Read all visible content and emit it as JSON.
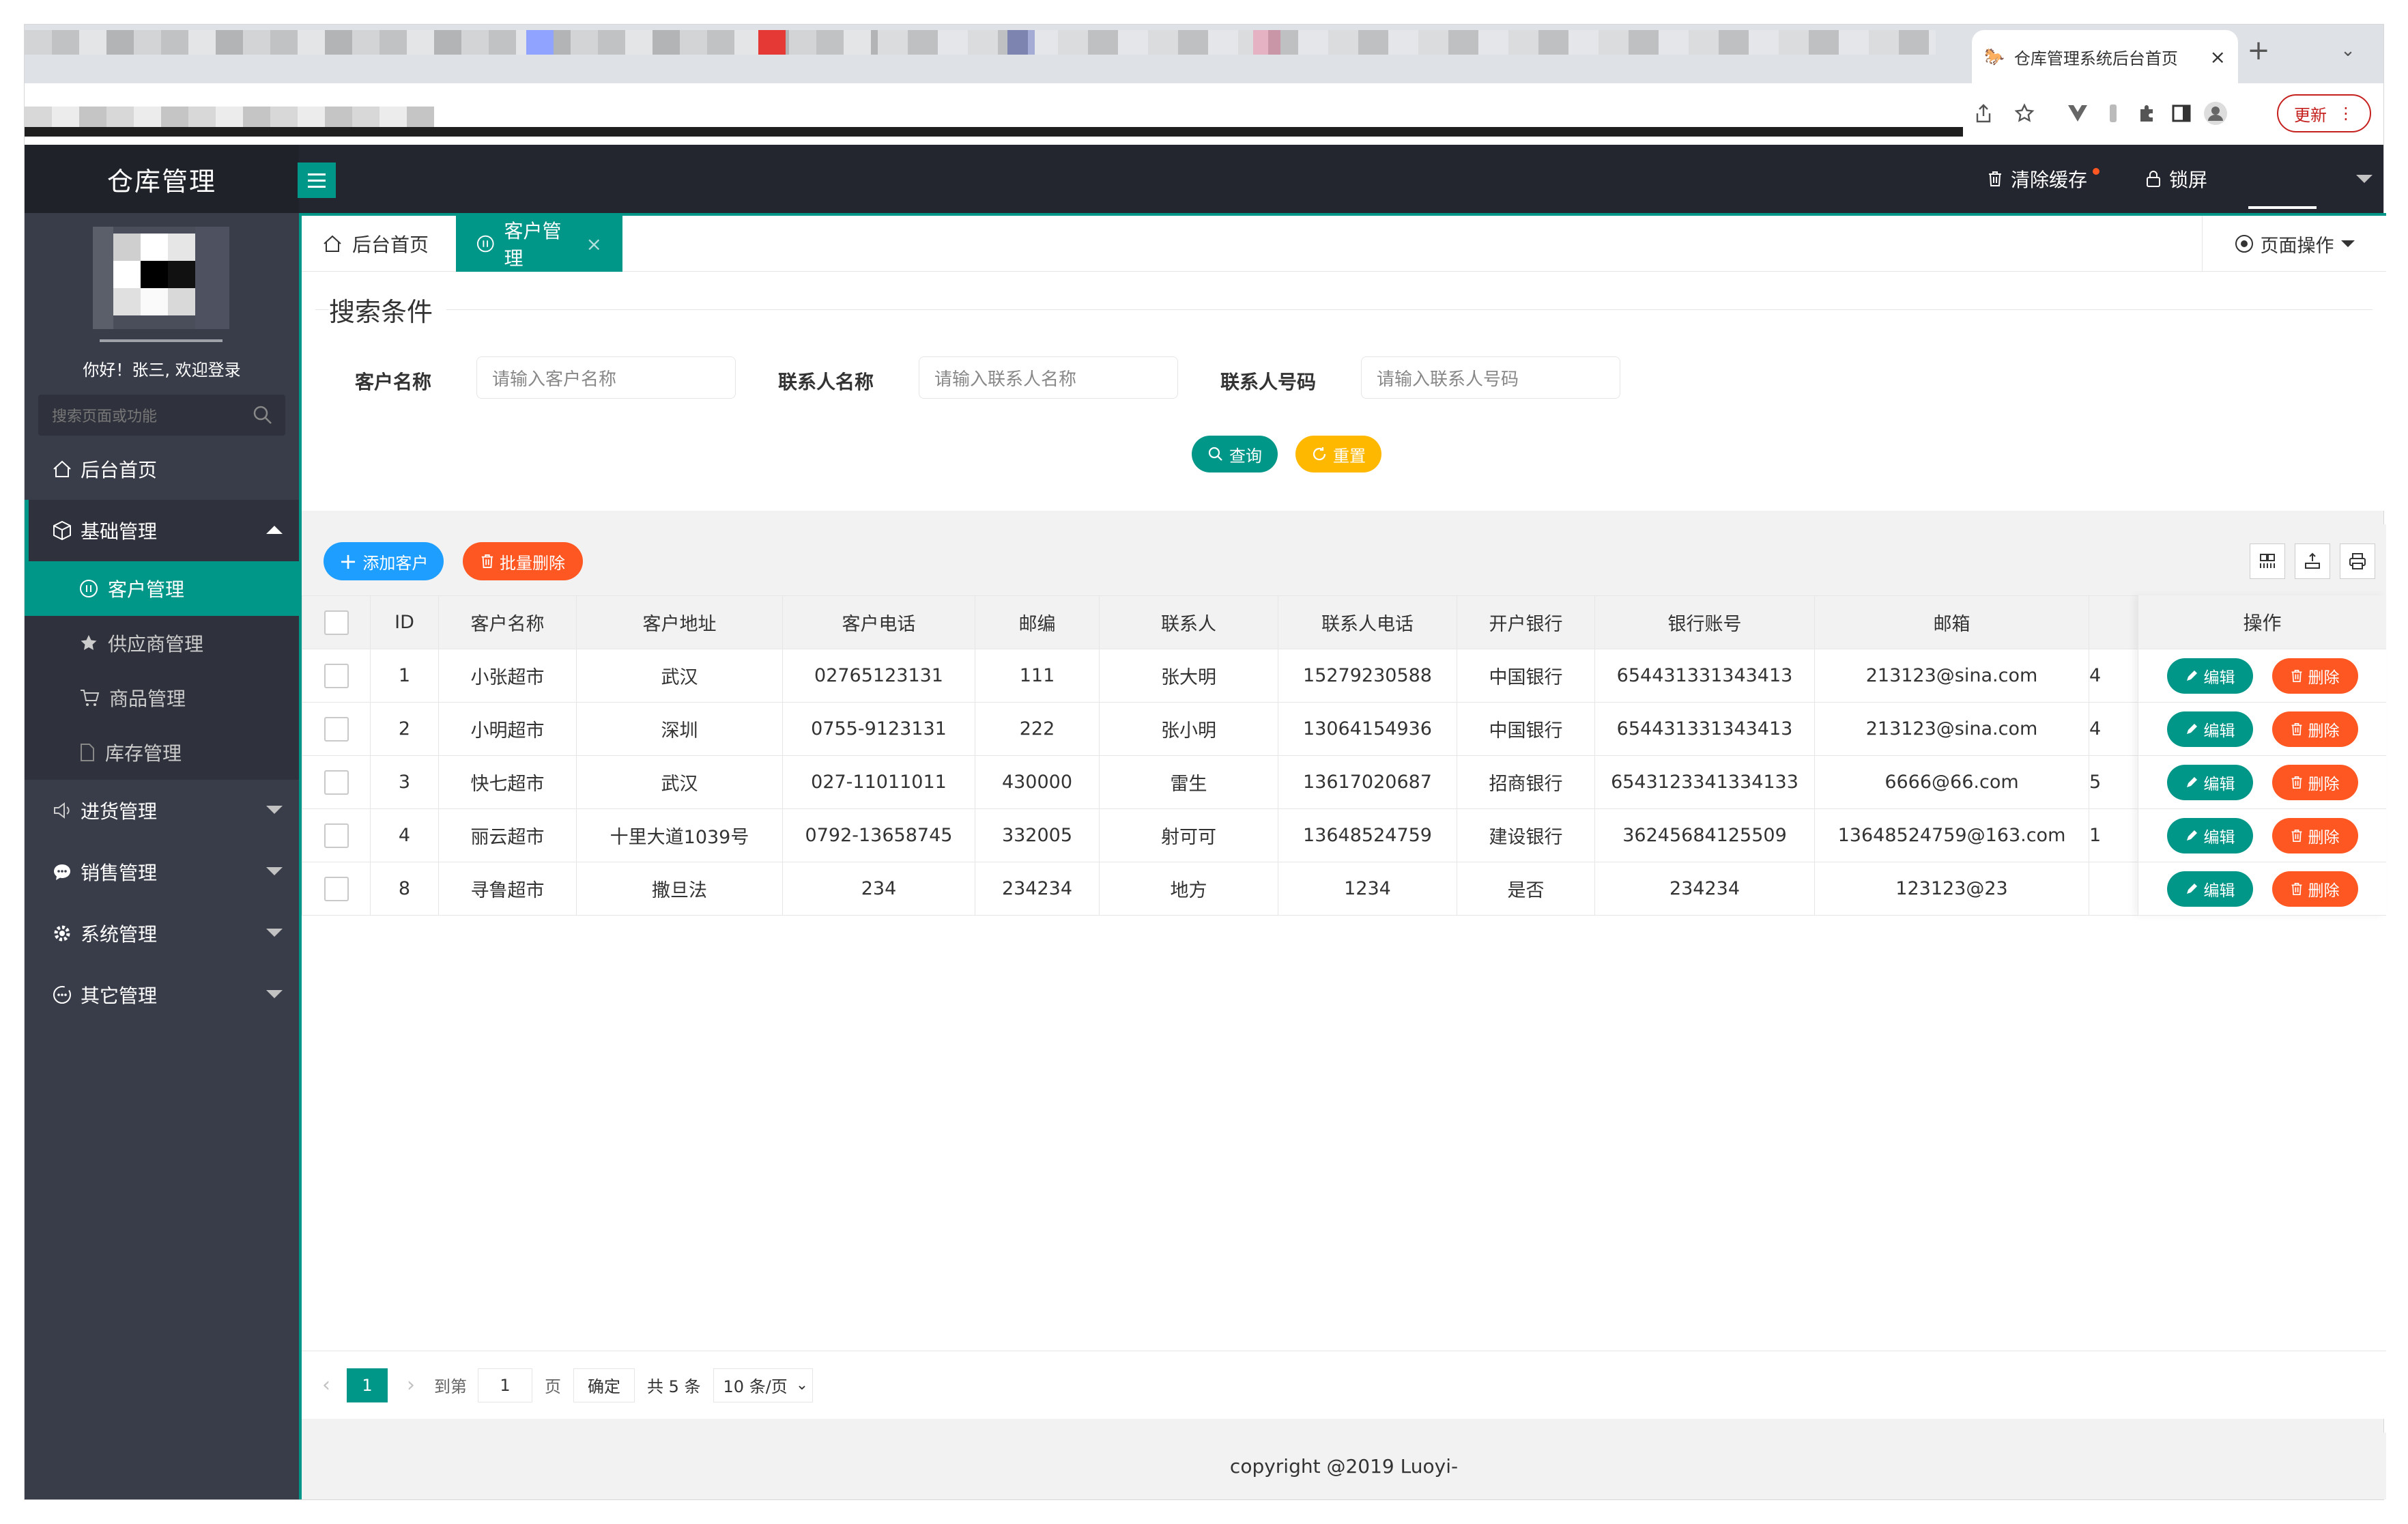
{
  "browser": {
    "tab_title": "仓库管理系统后台首页",
    "update_label": "更新"
  },
  "header": {
    "app_title": "仓库管理",
    "clear_cache": "清除缓存",
    "lock_screen": "锁屏"
  },
  "sidebar": {
    "welcome": "你好！张三, 欢迎登录",
    "search_placeholder": "搜索页面或功能",
    "items": {
      "home": "后台首页",
      "basic": "基础管理",
      "customer": "客户管理",
      "supplier": "供应商管理",
      "goods": "商品管理",
      "stock": "库存管理",
      "purchase": "进货管理",
      "sales": "销售管理",
      "system": "系统管理",
      "other": "其它管理"
    }
  },
  "tabs": {
    "home": "后台首页",
    "customer": "客户管理",
    "page_ops": "页面操作"
  },
  "search": {
    "legend": "搜索条件",
    "customer_name_label": "客户名称",
    "customer_name_placeholder": "请输入客户名称",
    "contact_name_label": "联系人名称",
    "contact_name_placeholder": "请输入联系人名称",
    "contact_phone_label": "联系人号码",
    "contact_phone_placeholder": "请输入联系人号码",
    "query_label": "查询",
    "reset_label": "重置"
  },
  "toolbar": {
    "add_label": "添加客户",
    "batch_delete_label": "批量删除"
  },
  "table": {
    "headers": [
      "ID",
      "客户名称",
      "客户地址",
      "客户电话",
      "邮编",
      "联系人",
      "联系人电话",
      "开户银行",
      "银行账号",
      "邮箱"
    ],
    "ops_header": "操作",
    "edit_label": "编辑",
    "delete_label": "删除",
    "rows": [
      [
        "1",
        "小张超市",
        "武汉",
        "02765123131",
        "111",
        "张大明",
        "15279230588",
        "中国银行",
        "654431331343413",
        "213123@sina.com",
        "4"
      ],
      [
        "2",
        "小明超市",
        "深圳",
        "0755-9123131",
        "222",
        "张小明",
        "13064154936",
        "中国银行",
        "654431331343413",
        "213123@sina.com",
        "4"
      ],
      [
        "3",
        "快七超市",
        "武汉",
        "027-11011011",
        "430000",
        "雷生",
        "13617020687",
        "招商银行",
        "6543123341334133",
        "6666@66.com",
        "5"
      ],
      [
        "4",
        "丽云超市",
        "十里大道1039号",
        "0792-13658745",
        "332005",
        "射可可",
        "13648524759",
        "建设银行",
        "36245684125509",
        "13648524759@163.com",
        "1"
      ],
      [
        "8",
        "寻鲁超市",
        "撒旦法",
        "234",
        "234234",
        "地方",
        "1234",
        "是否",
        "234234",
        "123123@23",
        ""
      ]
    ]
  },
  "pager": {
    "current_page": "1",
    "goto_label": "到第",
    "goto_value": "1",
    "page_unit": "页",
    "confirm_label": "确定",
    "total_label": "共 5 条",
    "page_size": "10 条/页"
  },
  "footer": {
    "copyright": "copyright @2019 Luoyi-"
  },
  "colors": {
    "accent": "#009688",
    "danger": "#ff5722",
    "warn": "#ffb800",
    "primary": "#1e9fff",
    "sidebar": "#393d49",
    "header": "#23262e"
  }
}
